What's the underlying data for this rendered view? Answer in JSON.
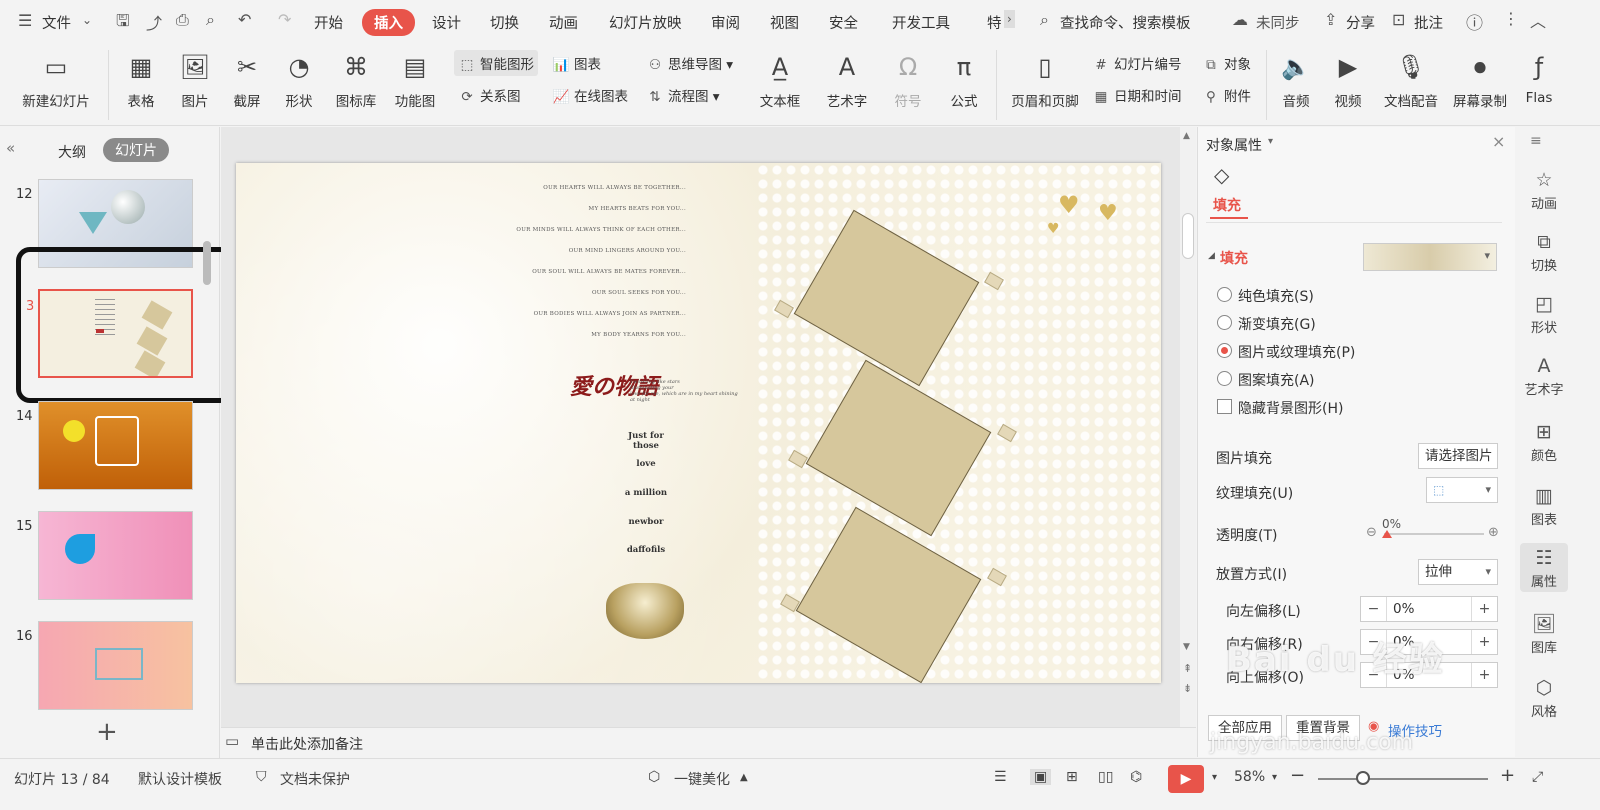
{
  "menubar": {
    "file_label": "文件",
    "tabs": [
      "开始",
      "插入",
      "设计",
      "切换",
      "动画",
      "幻灯片放映",
      "审阅",
      "视图",
      "安全",
      "开发工具",
      "特"
    ],
    "active_tab": "插入",
    "search_label": "查找命令、搜索模板",
    "sync_label": "未同步",
    "share_label": "分享",
    "comment_label": "批注"
  },
  "ribbon": {
    "new_slide": "新建幻灯片",
    "table": "表格",
    "picture": "图片",
    "screenshot": "截屏",
    "shape": "形状",
    "icon_lib": "图标库",
    "function_chart": "功能图",
    "smart_art": "智能图形",
    "chart": "图表",
    "mind_map": "思维导图",
    "relation": "关系图",
    "online_chart": "在线图表",
    "flowchart": "流程图",
    "textbox": "文本框",
    "word_art": "艺术字",
    "symbol": "符号",
    "formula": "公式",
    "header_footer": "页眉和页脚",
    "slide_number": "幻灯片编号",
    "object": "对象",
    "date_time": "日期和时间",
    "attachment": "附件",
    "audio": "音频",
    "video": "视频",
    "doc_voice": "文档配音",
    "screen_record": "屏幕录制",
    "flash": "Flas"
  },
  "left_pane": {
    "outline_tab": "大纲",
    "slides_tab": "幻灯片",
    "slide_numbers": [
      "12",
      "3",
      "14",
      "15",
      "16"
    ],
    "add_symbol": "+"
  },
  "slide": {
    "poem_lines": [
      "OUR HEARTS WILL ALWAYS BE TOGETHER...",
      "MY HEARTS BEATS FOR YOU...",
      "OUR MINDS WILL ALWAYS THINK OF EACH OTHER...",
      "OUR MIND LINGERS AROUND YOU...",
      "OUR SOUL WILL ALWAYS BE MATES FOREVER...",
      "OUR SOUL SEEKS FOR YOU...",
      "OUR BODIES WILL ALWAYS JOIN AS PARTNER...",
      "MY BODY YEARNS FOR YOU..."
    ],
    "logo_text": "愛の物語",
    "logo_sub": "Twinkling like stars\nilluminating your\nlove for me, which are in my heart shining\nat night",
    "words": [
      "Just for those",
      "love",
      "a million",
      "newbor",
      "daffofils"
    ]
  },
  "panel": {
    "title": "对象属性",
    "fill_tab": "填充",
    "fill_section": "填充",
    "options": [
      "纯色填充(S)",
      "渐变填充(G)",
      "图片或纹理填充(P)",
      "图案填充(A)"
    ],
    "hide_bg": "隐藏背景图形(H)",
    "pic_fill_label": "图片填充",
    "pic_fill_btn": "请选择图片",
    "texture_label": "纹理填充(U)",
    "transparency_label": "透明度(T)",
    "transparency_value": "0%",
    "placement_label": "放置方式(I)",
    "placement_value": "拉伸",
    "offset_left_label": "向左偏移(L)",
    "offset_left_value": "0%",
    "offset_right_label": "向右偏移(R)",
    "offset_right_value": "0%",
    "offset_top_label": "向上偏移(O)",
    "offset_top_value": "0%",
    "apply_all": "全部应用",
    "reset_bg": "重置背景",
    "tips": "操作技巧"
  },
  "right_bar": [
    "动画",
    "切换",
    "形状",
    "艺术字",
    "颜色",
    "图表",
    "属性",
    "图库",
    "风格"
  ],
  "notes": {
    "placeholder": "单击此处添加备注"
  },
  "status": {
    "slide_pos": "幻灯片 13 / 84",
    "template": "默认设计模板",
    "protect": "文档未保护",
    "beautify": "一键美化",
    "zoom": "58%"
  },
  "watermark": {
    "text": "Bai du 经验",
    "url": "jingyan.baidu.com"
  }
}
